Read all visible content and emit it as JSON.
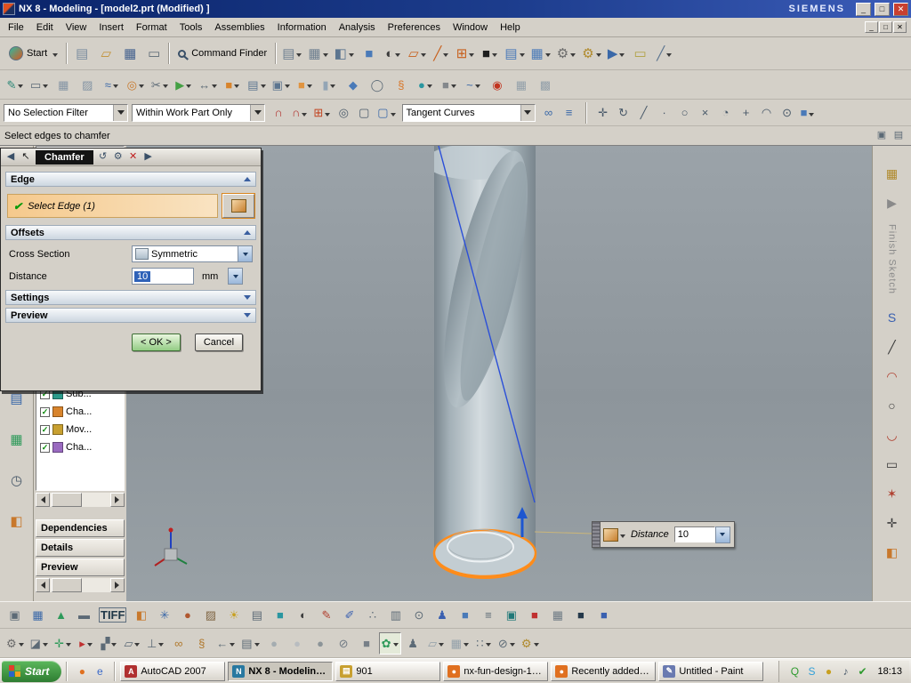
{
  "titlebar": {
    "title": "NX 8 - Modeling - [model2.prt (Modified) ]",
    "brand": "SIEMENS",
    "buttons": {
      "minimize": "_",
      "maximize": "□",
      "close": "✕"
    }
  },
  "menubar": {
    "items": [
      "File",
      "Edit",
      "View",
      "Insert",
      "Format",
      "Tools",
      "Assemblies",
      "Information",
      "Analysis",
      "Preferences",
      "Window",
      "Help"
    ],
    "window_buttons": [
      "_",
      "□",
      "✕"
    ]
  },
  "toolbar1": {
    "start_label": "Start",
    "command_finder_label": "Command Finder",
    "file_icons": [
      {
        "n": "new-file-icon",
        "g": "▤",
        "c": "#7d8ea0"
      },
      {
        "n": "open-file-icon",
        "g": "▱",
        "c": "#c39135"
      },
      {
        "n": "save-icon",
        "g": "▦",
        "c": "#44618e"
      },
      {
        "n": "print-icon",
        "g": "▭",
        "c": "#5c6a76"
      }
    ],
    "mid_icons": [
      {
        "n": "paste-icon",
        "g": "▤",
        "c": "#6e7f90",
        "d": 1
      },
      {
        "n": "view-layout-icon",
        "g": "▦",
        "c": "#6e7f90",
        "d": 1
      },
      {
        "n": "orient-view-icon",
        "g": "◧",
        "c": "#5c7590",
        "d": 1
      },
      {
        "n": "shaded-view-icon",
        "g": "■",
        "c": "#4a7ab8"
      },
      {
        "n": "render-style-icon",
        "g": "◐",
        "c": "#3c3c3c",
        "d": 1
      },
      {
        "n": "datum-plane-icon",
        "g": "▱",
        "c": "#c8601c",
        "d": 1
      },
      {
        "n": "datum-axis-icon",
        "g": "╱",
        "c": "#c8601c",
        "d": 1
      },
      {
        "n": "datum-csys-icon",
        "g": "⊞",
        "c": "#c8601c",
        "d": 1
      },
      {
        "n": "display-mode-icon",
        "g": "■",
        "c": "#1e1e1e",
        "d": 1
      },
      {
        "n": "drafting-sheet-icon",
        "g": "▤",
        "c": "#4a7ab8",
        "d": 1
      },
      {
        "n": "table-icon",
        "g": "▦",
        "c": "#4a7ab8",
        "d": 1
      },
      {
        "n": "machining-gear-icon",
        "g": "⚙",
        "c": "#6a6a6a",
        "d": 1
      },
      {
        "n": "tools-gear-icon",
        "g": "⚙",
        "c": "#b08a2c",
        "d": 1
      },
      {
        "n": "navigate-icon",
        "g": "▶",
        "c": "#3a68a8",
        "d": 1
      },
      {
        "n": "measure-icon",
        "g": "▭",
        "c": "#b0a040"
      },
      {
        "n": "analysis-slope-icon",
        "g": "╱",
        "c": "#5c7590",
        "d": 1
      }
    ]
  },
  "toolbar2": {
    "icons": [
      {
        "n": "sketch-icon",
        "g": "✎",
        "c": "#2e8878",
        "d": 1
      },
      {
        "n": "rectangle-tool-icon",
        "g": "▭",
        "c": "#5c6a76",
        "d": 1
      },
      {
        "n": "datum-grid-icon",
        "g": "▦",
        "c": "#8494a4"
      },
      {
        "n": "hatch-icon",
        "g": "▨",
        "c": "#8494a4"
      },
      {
        "n": "spline-icon",
        "g": "≈",
        "c": "#3a68a8",
        "d": 1
      },
      {
        "n": "revolve-icon",
        "g": "◎",
        "c": "#c8782c",
        "d": 1
      },
      {
        "n": "trim-icon",
        "g": "✂",
        "c": "#5c6a76",
        "d": 1
      },
      {
        "n": "extrude-direction-icon",
        "g": "▶",
        "c": "#44a044",
        "d": 1
      },
      {
        "n": "dimension-icon",
        "g": "↔",
        "c": "#5c6a76",
        "d": 1
      },
      {
        "n": "block-icon",
        "g": "■",
        "c": "#d8842c",
        "d": 1
      },
      {
        "n": "sheet-body-icon",
        "g": "▤",
        "c": "#5c7590",
        "d": 1
      },
      {
        "n": "window-icon",
        "g": "▣",
        "c": "#5c7590",
        "d": 1
      },
      {
        "n": "boss-icon",
        "g": "■",
        "c": "#e09440",
        "d": 1
      },
      {
        "n": "cylinder-icon",
        "g": "▮",
        "c": "#93a5b5",
        "d": 1
      },
      {
        "n": "wedge-icon",
        "g": "◆",
        "c": "#4a7ab8"
      },
      {
        "n": "ellipse-icon",
        "g": "◯",
        "c": "#5c6a76"
      },
      {
        "n": "helix-icon",
        "g": "§",
        "c": "#d8782c"
      },
      {
        "n": "sphere-icon",
        "g": "●",
        "c": "#2a96a0",
        "d": 1
      },
      {
        "n": "gray-block-icon",
        "g": "■",
        "c": "#84888c",
        "d": 1
      },
      {
        "n": "freeform-surface-icon",
        "g": "~",
        "c": "#3a68a8",
        "d": 1
      },
      {
        "n": "point-target-icon",
        "g": "◉",
        "c": "#c23420"
      },
      {
        "n": "fine-grid-icon",
        "g": "▦",
        "c": "#93a0aa"
      },
      {
        "n": "coarse-grid-icon",
        "g": "▩",
        "c": "#93a0aa"
      }
    ]
  },
  "selection_bar": {
    "filter_value": "No Selection Filter",
    "scope_value": "Within Work Part Only",
    "curve_value": "Tangent Curves",
    "icons_a": [
      {
        "n": "magnet-icon",
        "g": "∩",
        "c": "#b23430"
      },
      {
        "n": "magnet-plus-icon",
        "g": "∩",
        "c": "#b23430",
        "d": 1
      },
      {
        "n": "snap-grid-icon",
        "g": "⊞",
        "c": "#c24420",
        "d": 1
      },
      {
        "n": "probe-circle-icon",
        "g": "◎",
        "c": "#4a5a6a"
      },
      {
        "n": "pick-box-icon",
        "g": "▢",
        "c": "#4a5a6a"
      },
      {
        "n": "marquee-select-icon",
        "g": "▢",
        "c": "#3a68a8",
        "d": 1
      }
    ],
    "icons_b": [
      {
        "n": "curve-chain-icon",
        "g": "∞",
        "c": "#3a68a8"
      },
      {
        "n": "curve-group-icon",
        "g": "≡",
        "c": "#3a68a8"
      }
    ],
    "snap_icons": [
      {
        "n": "pan-snap-icon",
        "g": "✛",
        "c": "#4a5a6a"
      },
      {
        "n": "rotate-snap-icon",
        "g": "↻",
        "c": "#4a5a6a"
      },
      {
        "n": "end-point-icon",
        "g": "╱",
        "c": "#4a5a6a"
      },
      {
        "n": "mid-point-icon",
        "g": "∙",
        "c": "#4a5a6a"
      },
      {
        "n": "center-point-icon",
        "g": "○",
        "c": "#4a5a6a"
      },
      {
        "n": "intersection-point-icon",
        "g": "×",
        "c": "#4a5a6a"
      },
      {
        "n": "arc-quadrant-icon",
        "g": "◔",
        "c": "#4a5a6a"
      },
      {
        "n": "existing-point-icon",
        "g": "+",
        "c": "#4a5a6a"
      },
      {
        "n": "tangent-point-icon",
        "g": "◠",
        "c": "#4a5a6a"
      },
      {
        "n": "point-on-curve-icon",
        "g": "⊙",
        "c": "#4a5a6a"
      },
      {
        "n": "snap-cube-icon",
        "g": "■",
        "c": "#4a7ab8",
        "d": 1
      }
    ]
  },
  "prompt": {
    "text": "Select edges to chamfer",
    "icons": [
      {
        "n": "cue-dock-icon",
        "g": "▣",
        "c": "#5c6a76"
      },
      {
        "n": "cue-panel-icon",
        "g": "▤",
        "c": "#5c6a76"
      }
    ]
  },
  "dialog": {
    "title": "Chamfer",
    "header_left_icons": [
      {
        "n": "dialog-back-icon",
        "g": "◀",
        "c": "#3a5068"
      },
      {
        "n": "dialog-selection-cursor-icon",
        "g": "↖",
        "c": "#1a1a1a"
      }
    ],
    "header_right_icons": [
      {
        "n": "dialog-reset-icon",
        "g": "↺",
        "c": "#3a5068"
      },
      {
        "n": "dialog-gear-icon",
        "g": "⚙",
        "c": "#3a5068"
      },
      {
        "n": "dialog-close-icon",
        "g": "✕",
        "c": "#c02020"
      },
      {
        "n": "dialog-forward-icon",
        "g": "▶",
        "c": "#3a5068"
      }
    ],
    "edge_group_label": "Edge",
    "select_edge_check": "✔",
    "select_edge_label": "Select Edge (1)",
    "offsets_group_label": "Offsets",
    "cross_section_label": "Cross Section",
    "cross_section_value": "Symmetric",
    "distance_label": "Distance",
    "distance_value": "10",
    "distance_unit": "mm",
    "settings_group_label": "Settings",
    "preview_group_label": "Preview",
    "ok_label": "< OK >",
    "cancel_label": "Cancel"
  },
  "navigator": {
    "check_glyph": "✓",
    "tree_items": [
      {
        "label": "Sub...",
        "color": "#2a9a8a"
      },
      {
        "label": "Cha...",
        "color": "#d8842c"
      },
      {
        "label": "Mov...",
        "color": "#c8a030"
      },
      {
        "label": "Cha...",
        "color": "#9a6ac0"
      }
    ],
    "sections": [
      "Dependencies",
      "Details",
      "Preview"
    ]
  },
  "resource_bar": {
    "icons": [
      {
        "n": "hd3d-tools-icon",
        "g": "▤",
        "c": "#3a68a8"
      },
      {
        "n": "reuse-library-icon",
        "g": "▦",
        "c": "#2e9a5a"
      },
      {
        "n": "history-icon",
        "g": "◷",
        "c": "#4a5a6a"
      },
      {
        "n": "roles-icon",
        "g": "◧",
        "c": "#c8782c"
      }
    ]
  },
  "right_toolbar": {
    "finish_label": "Finish Sketch",
    "top_icons": [
      {
        "n": "sketch-in-task-icon",
        "g": "▦",
        "c": "#b08a2c"
      },
      {
        "n": "finish-sketch-flag-icon",
        "g": "▶",
        "c": "#8a8a8a"
      }
    ],
    "tool_icons": [
      {
        "n": "profile-icon",
        "g": "S",
        "c": "#3a60b0"
      },
      {
        "n": "line-icon",
        "g": "╱",
        "c": "#3c3c3c"
      },
      {
        "n": "arc-icon",
        "g": "◠",
        "c": "#b04030"
      },
      {
        "n": "circle-icon",
        "g": "○",
        "c": "#3c3c3c"
      },
      {
        "n": "conic-icon",
        "g": "◡",
        "c": "#b04030"
      },
      {
        "n": "rectangle-icon",
        "g": "▭",
        "c": "#3c3c3c"
      },
      {
        "n": "studio-spline-icon",
        "g": "✶",
        "c": "#b04030"
      },
      {
        "n": "point-icon",
        "g": "✛",
        "c": "#3c3c3c"
      },
      {
        "n": "sketch-palette-icon",
        "g": "◧",
        "c": "#c8782c"
      }
    ]
  },
  "viewport": {
    "floating_input": {
      "label": "Distance",
      "value": "10"
    }
  },
  "bottom_row1": {
    "icons": [
      {
        "n": "snapshot-icon",
        "g": "▣",
        "c": "#5c6a76"
      },
      {
        "n": "image-export-icon",
        "g": "▦",
        "c": "#3a68a8"
      },
      {
        "n": "chart-icon",
        "g": "▲",
        "c": "#2e9a5a"
      },
      {
        "n": "movie-icon",
        "g": "▬",
        "c": "#5c6a76"
      },
      {
        "n": "tiff-export-icon",
        "g": "TIFF",
        "c": "#203848",
        "t": 1
      },
      {
        "n": "palette-icon",
        "g": "◧",
        "c": "#c8782c"
      },
      {
        "n": "effects-icon",
        "g": "✳",
        "c": "#3a68a8"
      },
      {
        "n": "material-icon",
        "g": "●",
        "c": "#b05830"
      },
      {
        "n": "texture-icon",
        "g": "▨",
        "c": "#806644"
      },
      {
        "n": "light-icon",
        "g": "☀",
        "c": "#c8a020"
      },
      {
        "n": "scene-icon",
        "g": "▤",
        "c": "#5c6a76"
      },
      {
        "n": "true-shading-icon",
        "g": "■",
        "c": "#2a96a0"
      },
      {
        "n": "ray-trace-icon",
        "g": "◐",
        "c": "#3c3c3c"
      },
      {
        "n": "art-pen-icon",
        "g": "✎",
        "c": "#b04030"
      },
      {
        "n": "ink-pen-icon",
        "g": "✐",
        "c": "#3a60b0"
      },
      {
        "n": "spray-icon",
        "g": "∴",
        "c": "#5c6a76"
      },
      {
        "n": "panel-icon",
        "g": "▥",
        "c": "#5c6a76"
      },
      {
        "n": "probe-icon",
        "g": "⊙",
        "c": "#5c6a76"
      },
      {
        "n": "user-view-icon",
        "g": "♟",
        "c": "#3a60b0"
      },
      {
        "n": "cube-view-icon",
        "g": "■",
        "c": "#4a7ab8"
      },
      {
        "n": "layers-icon",
        "g": "≡",
        "c": "#5c6a76"
      },
      {
        "n": "teal-cube-icon",
        "g": "▣",
        "c": "#207878"
      },
      {
        "n": "red-block-icon",
        "g": "■",
        "c": "#c03030"
      },
      {
        "n": "grid-block-icon",
        "g": "▦",
        "c": "#6e7a84"
      },
      {
        "n": "dark-cube-icon",
        "g": "■",
        "c": "#24384a"
      },
      {
        "n": "blue-cube-icon",
        "g": "■",
        "c": "#3a60b0"
      }
    ]
  },
  "bottom_row2": {
    "icons": [
      {
        "n": "view-gear-icon",
        "g": "⚙",
        "c": "#6a6a6a",
        "d": 1
      },
      {
        "n": "display-cube-icon",
        "g": "◪",
        "c": "#5c6a76",
        "d": 1
      },
      {
        "n": "add-view-icon",
        "g": "✛",
        "c": "#2e9a5a",
        "d": 1
      },
      {
        "n": "flag-icon",
        "g": "▸",
        "c": "#c03030",
        "d": 1
      },
      {
        "n": "pattern-icon",
        "g": "▞",
        "c": "#5c6a76",
        "d": 1
      },
      {
        "n": "plane-icon",
        "g": "▱",
        "c": "#5c6a76",
        "d": 1
      },
      {
        "n": "perpendicular-icon",
        "g": "⊥",
        "c": "#5c6a76",
        "d": 1
      },
      {
        "n": "chain-link-icon",
        "g": "∞",
        "c": "#b0782c"
      },
      {
        "n": "section-icon",
        "g": "§",
        "c": "#b0782c"
      },
      {
        "n": "back-arrow-icon",
        "g": "←",
        "c": "#5c6a76",
        "d": 1
      },
      {
        "n": "note-icon",
        "g": "▤",
        "c": "#5c6a76",
        "d": 1
      },
      {
        "n": "sphere-gray-icon",
        "g": "●",
        "c": "#a4acb0"
      },
      {
        "n": "ellipse-light-icon",
        "g": "●",
        "c": "#b8bcc0"
      },
      {
        "n": "ellipse-dark-icon",
        "g": "●",
        "c": "#8c9498"
      },
      {
        "n": "no-snap-icon",
        "g": "⊘",
        "c": "#707a84"
      },
      {
        "n": "gray-square-icon",
        "g": "■",
        "c": "#788088"
      },
      {
        "n": "render-leaf-icon",
        "g": "✿",
        "c": "#2e9a5a",
        "active": 1,
        "d": 1
      },
      {
        "n": "operator-icon",
        "g": "♟",
        "c": "#5c6a76"
      },
      {
        "n": "plane-light-icon",
        "g": "▱",
        "c": "#93a0aa",
        "d": 1
      },
      {
        "n": "grid-light-icon",
        "g": "▦",
        "c": "#93a0aa",
        "d": 1
      },
      {
        "n": "dots-icon",
        "g": "∷",
        "c": "#5c6a76",
        "d": 1
      },
      {
        "n": "none-icon",
        "g": "⊘",
        "c": "#5c6a76",
        "d": 1
      },
      {
        "n": "gear-gold-icon",
        "g": "⚙",
        "c": "#b08a2c",
        "d": 1
      }
    ]
  },
  "taskbar": {
    "start_label": "Start",
    "quick_launch": [
      {
        "n": "quick-launch-firefox-icon",
        "g": "●",
        "c": "#e07020"
      },
      {
        "n": "quick-launch-explorer-icon",
        "g": "e",
        "c": "#3a68c8"
      }
    ],
    "tasks": [
      {
        "label": "AutoCAD 2007",
        "g": "A",
        "c": "#b03030"
      },
      {
        "label": "NX 8 - Modeling ...",
        "g": "N",
        "c": "#2878a0",
        "active": true
      },
      {
        "label": "901",
        "g": "▤",
        "c": "#c8a030"
      },
      {
        "label": "nx-fun-design-1.s...",
        "g": "●",
        "c": "#e07020"
      },
      {
        "label": "Recently added N...",
        "g": "●",
        "c": "#e07020"
      },
      {
        "label": "Untitled - Paint",
        "g": "✎",
        "c": "#6a7ab0"
      }
    ],
    "tray": [
      {
        "n": "tray-messenger-icon",
        "g": "Q",
        "c": "#2e9a2e"
      },
      {
        "n": "tray-chat-icon",
        "g": "S",
        "c": "#32a0d8"
      },
      {
        "n": "tray-update-icon",
        "g": "●",
        "c": "#c8a020"
      },
      {
        "n": "tray-volume-icon",
        "g": "♪",
        "c": "#4a5a6a"
      },
      {
        "n": "tray-antivirus-icon",
        "g": "✔",
        "c": "#2e9a2e"
      }
    ],
    "clock": "18:13"
  }
}
